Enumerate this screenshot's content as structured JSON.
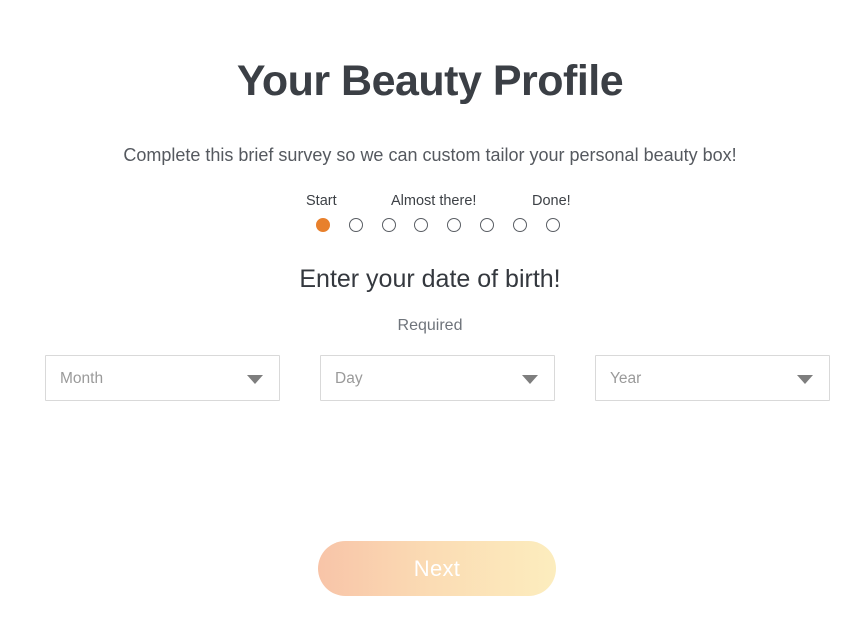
{
  "header": {
    "title": "Your Beauty Profile",
    "subtitle": "Complete this brief survey so we can custom tailor your personal beauty box!"
  },
  "progress": {
    "labels": {
      "start": "Start",
      "middle": "Almost there!",
      "end": "Done!"
    },
    "total_steps": 8,
    "current_step": 1,
    "filled_color": "#e8802c",
    "empty_border_color": "#5a5e64"
  },
  "question": {
    "title": "Enter your date of birth!",
    "required_label": "Required"
  },
  "inputs": {
    "month": {
      "placeholder": "Month",
      "value": "",
      "icon": "chevron-down-icon"
    },
    "day": {
      "placeholder": "Day",
      "value": "",
      "icon": "chevron-down-icon"
    },
    "year": {
      "placeholder": "Year",
      "value": "",
      "icon": "chevron-down-icon"
    }
  },
  "actions": {
    "next_label": "Next",
    "next_gradient_from": "#f8c4a8",
    "next_gradient_to": "#fcedbe",
    "next_text_color": "#ffffff",
    "next_enabled": false
  }
}
